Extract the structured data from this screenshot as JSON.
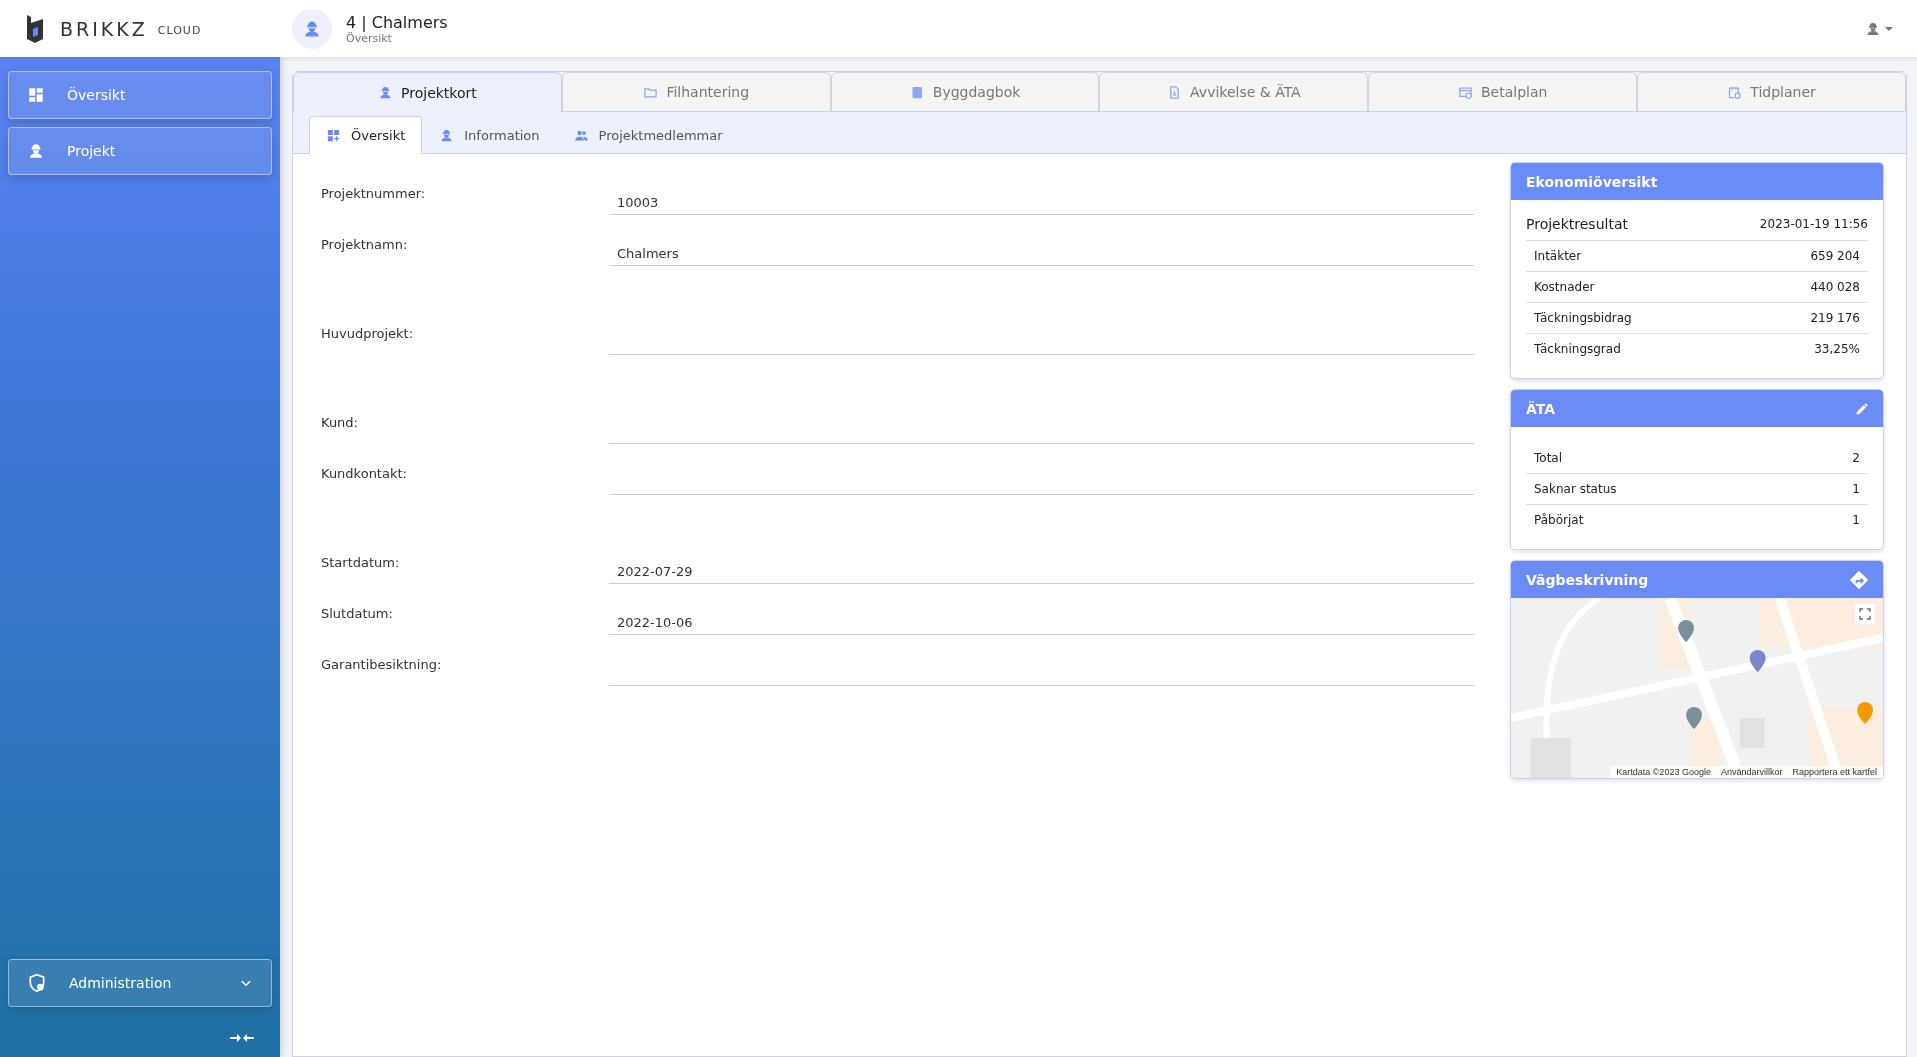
{
  "brand": {
    "name": "BRIKKZ",
    "suffix": "CLOUD"
  },
  "header": {
    "title": "4 | Chalmers",
    "subtitle": "Översikt"
  },
  "sidebar": {
    "items": [
      {
        "label": "Översikt"
      },
      {
        "label": "Projekt"
      }
    ],
    "admin": {
      "label": "Administration",
      "expanded": false
    }
  },
  "tabs": [
    {
      "label": "Projektkort",
      "selected": true
    },
    {
      "label": "Filhantering",
      "selected": false
    },
    {
      "label": "Byggdagbok",
      "selected": false
    },
    {
      "label": "Avvikelse & ÄTA",
      "selected": false
    },
    {
      "label": "Betalplan",
      "selected": false
    },
    {
      "label": "Tidplaner",
      "selected": false
    }
  ],
  "subtabs": [
    {
      "label": "Översikt",
      "selected": true
    },
    {
      "label": "Information",
      "selected": false
    },
    {
      "label": "Projektmedlemmar",
      "selected": false
    }
  ],
  "form_sections": [
    [
      {
        "label": "Projektnummer:",
        "value": "10003"
      },
      {
        "label": "Projektnamn:",
        "value": "Chalmers"
      }
    ],
    [
      {
        "label": "Huvudprojekt:"
      }
    ],
    [
      {
        "label": "Kund:"
      },
      {
        "label": "Kundkontakt:"
      }
    ],
    [
      {
        "label": "Startdatum:",
        "value": "2022-07-29"
      },
      {
        "label": "Slutdatum:",
        "value": "2022-10-06"
      },
      {
        "label": "Garantibesiktning:"
      }
    ]
  ],
  "economy": {
    "title": "Ekonomiöversikt",
    "result_label": "Projektresultat",
    "result_date": "2023-01-19 11:56",
    "rows": [
      {
        "label": "Intäkter",
        "value": "659 204"
      },
      {
        "label": "Kostnader",
        "value": "440 028"
      },
      {
        "label": "Täckningsbidrag",
        "value": "219 176"
      },
      {
        "label": "Täckningsgrad",
        "value": "33,25%"
      }
    ]
  },
  "ata": {
    "title": "ÄTA",
    "rows": [
      {
        "label": "Total",
        "value": "2"
      },
      {
        "label": "Saknar status",
        "value": "1"
      },
      {
        "label": "Påbörjat",
        "value": "1"
      }
    ]
  },
  "directions": {
    "title": "Vägbeskrivning",
    "map": {
      "kind": "picture",
      "attribution": [
        "Kartdata ©2023 Google",
        "Användarvillkor",
        "Rapportera ett kartfel"
      ]
    }
  }
}
